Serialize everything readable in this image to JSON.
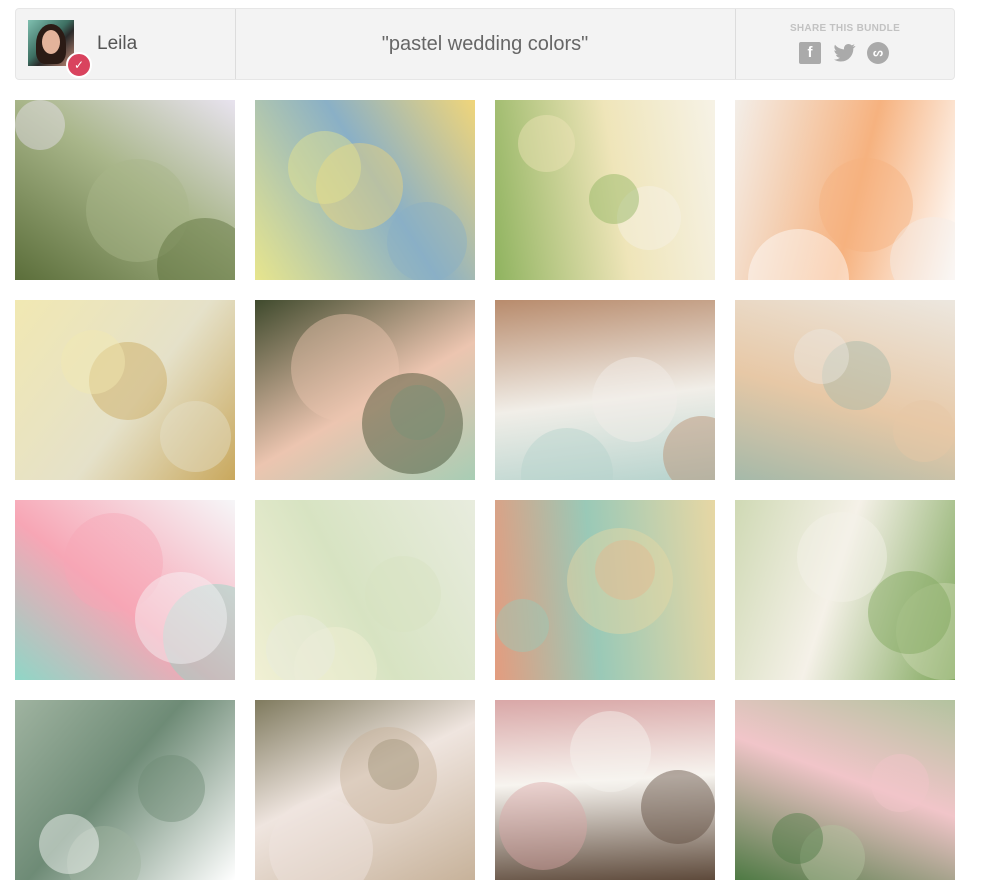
{
  "header": {
    "user_name": "Leila",
    "verified_icon": "checkmark-icon",
    "bundle_title": "\"pastel wedding colors\"",
    "share_label": "SHARE THIS BUNDLE",
    "share_icons": [
      "facebook-icon",
      "twitter-icon",
      "stumbleupon-icon"
    ]
  },
  "photos": [
    {
      "name": "photo-couple-balloons",
      "colors": [
        "#5b6e3a",
        "#a9b68a",
        "#e8e3ef"
      ]
    },
    {
      "name": "photo-macaron-box",
      "colors": [
        "#e7e58d",
        "#8ab0c6",
        "#f0d57a"
      ]
    },
    {
      "name": "photo-bride-bouquet",
      "colors": [
        "#8fb35f",
        "#efe5b9",
        "#f6f2e6"
      ]
    },
    {
      "name": "photo-pastel-cake",
      "colors": [
        "#f3eee8",
        "#f6b27f",
        "#ffffff"
      ]
    },
    {
      "name": "photo-yellow-balloons",
      "colors": [
        "#f1e8b2",
        "#e5e1c9",
        "#c9a85d"
      ]
    },
    {
      "name": "photo-bridesmaids",
      "colors": [
        "#3f4a2d",
        "#ecc5b0",
        "#a8cdb4"
      ]
    },
    {
      "name": "photo-paper-lanterns",
      "colors": [
        "#b88b6c",
        "#f1eee8",
        "#b6d3cd"
      ]
    },
    {
      "name": "photo-bridal-bouquet",
      "colors": [
        "#ece7df",
        "#e7c8a6",
        "#a5b9a9"
      ]
    },
    {
      "name": "photo-tassel-garland",
      "colors": [
        "#f6f6f8",
        "#f7a6b5",
        "#8fd6c6"
      ]
    },
    {
      "name": "photo-mason-jars",
      "colors": [
        "#e8ecde",
        "#d7e3c2",
        "#f1f0d4"
      ]
    },
    {
      "name": "photo-bow-ties",
      "colors": [
        "#e7d7a4",
        "#9ac9b7",
        "#e39c7f"
      ]
    },
    {
      "name": "photo-couple-swing",
      "colors": [
        "#7ea65a",
        "#f5f1e8",
        "#cfd9b4"
      ]
    },
    {
      "name": "photo-vintage-car",
      "colors": [
        "#ffffff",
        "#6e8b76",
        "#9fb3a0"
      ]
    },
    {
      "name": "photo-flower-bouquet",
      "colors": [
        "#c7b29a",
        "#efe5df",
        "#7f7a5e"
      ]
    },
    {
      "name": "photo-invitation",
      "colors": [
        "#5e4a3b",
        "#f7f4ef",
        "#d9a7a7"
      ]
    },
    {
      "name": "photo-pink-shoes",
      "colors": [
        "#4e7a44",
        "#f1c5c9",
        "#b3c39f"
      ]
    }
  ]
}
